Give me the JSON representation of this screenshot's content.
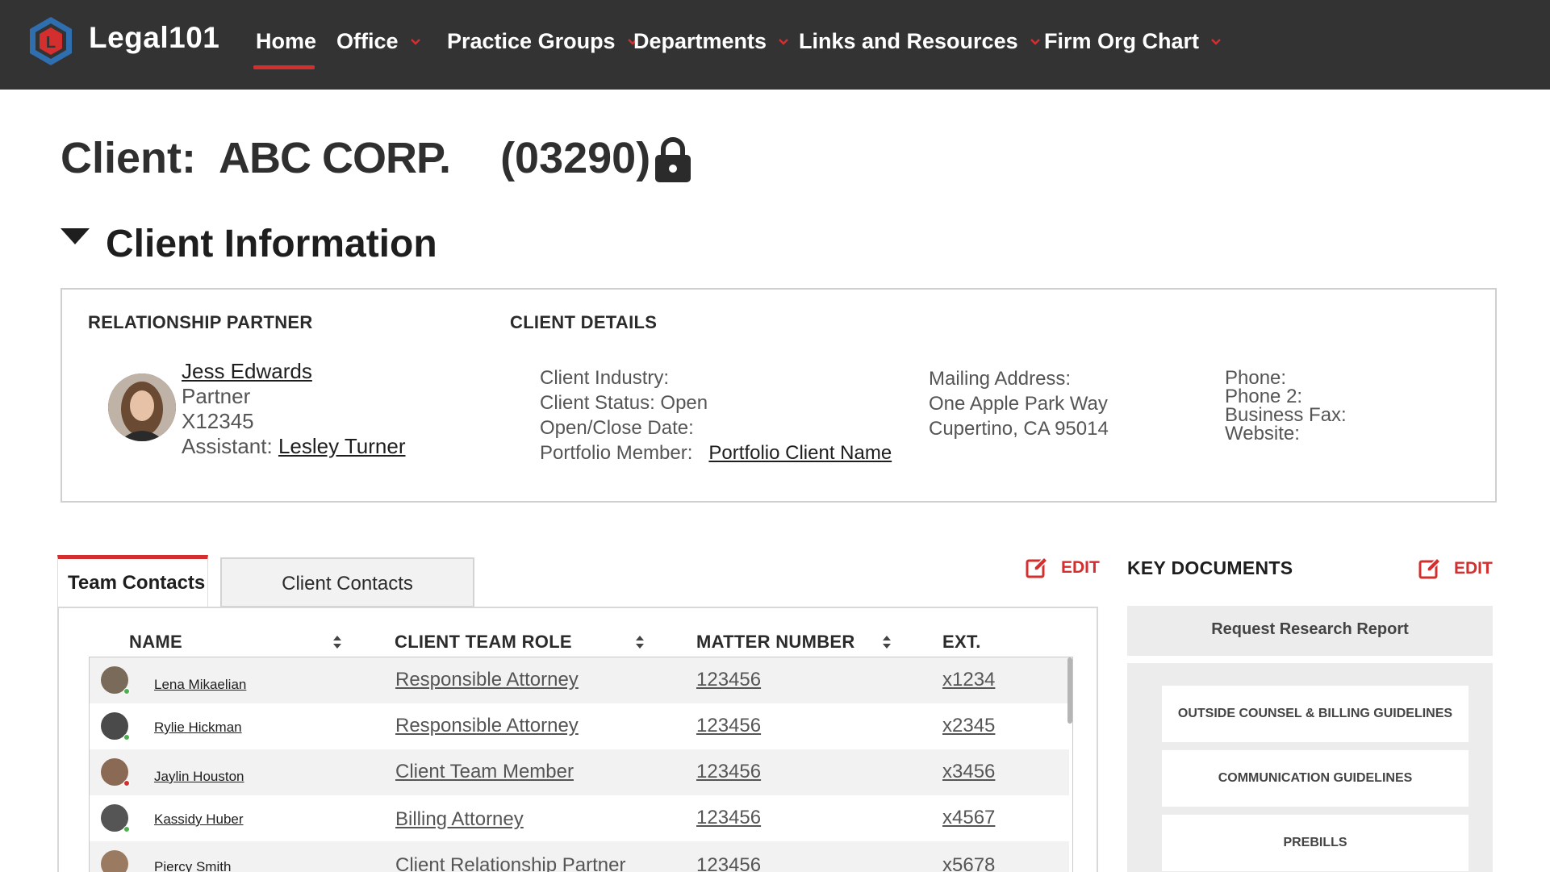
{
  "nav": {
    "brand": "Legal101",
    "items": [
      {
        "label": "Home"
      },
      {
        "label": "Office"
      },
      {
        "label": "Practice Groups"
      },
      {
        "label": "Departments"
      },
      {
        "label": "Links and Resources"
      },
      {
        "label": "Firm Org Chart"
      }
    ],
    "accent": "#d32f2f",
    "background": "#333333"
  },
  "page": {
    "client_label": "Client:",
    "client_name": "ABC CORP.",
    "client_number": "(03290)",
    "lock_icon": "lock-icon"
  },
  "section": {
    "title": "Client Information"
  },
  "relationship_partner": {
    "heading": "RELATIONSHIP PARTNER",
    "name": "Jess Edwards",
    "title": "Partner",
    "ext": "X12345",
    "assistant_label": "Assistant:",
    "assistant_name": "Lesley Turner"
  },
  "client_details": {
    "heading": "CLIENT DETAILS",
    "industry": "Client Industry:",
    "status": "Client Status: Open",
    "open_close": "Open/Close Date:",
    "portfolio_label": "Portfolio Member:",
    "portfolio_link": "Portfolio Client Name",
    "mailing_label": "Mailing Address:",
    "address_line1": "One Apple Park Way",
    "address_line2": "Cupertino, CA 95014",
    "phone": "Phone:",
    "phone2": "Phone 2:",
    "fax": "Business Fax:",
    "website": "Website:"
  },
  "tabs": {
    "team": "Team Contacts",
    "client": "Client Contacts",
    "edit": "EDIT"
  },
  "table": {
    "headers": {
      "name": "NAME",
      "role": "CLIENT TEAM ROLE",
      "matter": "MATTER NUMBER",
      "ext": "EXT."
    },
    "rows": [
      {
        "name": "Lena Mikaelian",
        "role": "Responsible Attorney",
        "matter": "123456",
        "ext": "x1234",
        "status": "online"
      },
      {
        "name": "Rylie Hickman",
        "role": "Responsible Attorney",
        "matter": "123456",
        "ext": "x2345",
        "status": "online"
      },
      {
        "name": "Jaylin Houston",
        "role": "Client Team Member",
        "matter": "123456",
        "ext": "x3456",
        "status": "busy"
      },
      {
        "name": "Kassidy Huber",
        "role": "Billing Attorney",
        "matter": "123456",
        "ext": "x4567",
        "status": "online"
      },
      {
        "name": "Piercy Smith",
        "role": "Client Relationship Partner",
        "matter": "123456",
        "ext": "x5678",
        "status": "online"
      }
    ]
  },
  "key_documents": {
    "title": "KEY DOCUMENTS",
    "edit": "EDIT",
    "request_button": "Request Research Report",
    "items": [
      {
        "label": "OUTSIDE COUNSEL & BILLING GUIDELINES"
      },
      {
        "label": "COMMUNICATION GUIDELINES"
      },
      {
        "label": "PREBILLS"
      }
    ]
  }
}
